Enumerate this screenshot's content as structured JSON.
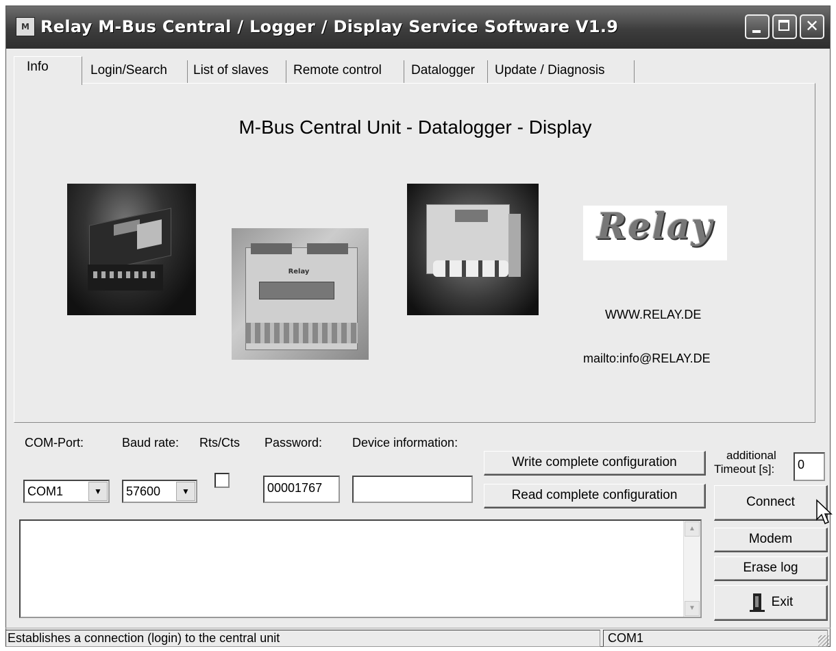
{
  "window": {
    "title": "Relay M-Bus Central / Logger / Display Service Software  V1.9",
    "close_symbol": "✕"
  },
  "tabs": [
    {
      "label": "Info",
      "active": true
    },
    {
      "label": "Login/Search"
    },
    {
      "label": "List of slaves"
    },
    {
      "label": "Remote control"
    },
    {
      "label": "Datalogger"
    },
    {
      "label": "Update / Diagnosis"
    }
  ],
  "info": {
    "heading": "M-Bus Central Unit - Datalogger - Display",
    "logo_text": "Relay",
    "website": "WWW.RELAY.DE",
    "email": "mailto:info@RELAY.DE"
  },
  "controls": {
    "com_port_label": "COM-Port:",
    "com_port_value": "COM1",
    "baud_rate_label": "Baud rate:",
    "baud_rate_value": "57600",
    "rts_cts_label": "Rts/Cts",
    "rts_cts_checked": false,
    "password_label": "Password:",
    "password_value": "00001767",
    "device_info_label": "Device information:",
    "device_info_value": "",
    "write_config_button": "Write complete configuration",
    "read_config_button": "Read complete configuration",
    "timeout_label_1": "additional",
    "timeout_label_2": "Timeout [s]:",
    "timeout_value": "0",
    "connect_button": "Connect",
    "modem_button": "Modem",
    "erase_log_button": "Erase log",
    "exit_button": "Exit"
  },
  "status_bar": {
    "message": "Establishes a connection (login) to the central unit",
    "port": "COM1"
  },
  "icons": {
    "dropdown_arrow": "▼",
    "scroll_up": "▲",
    "scroll_down": "▼",
    "exit_icon": "door-exit-icon"
  }
}
